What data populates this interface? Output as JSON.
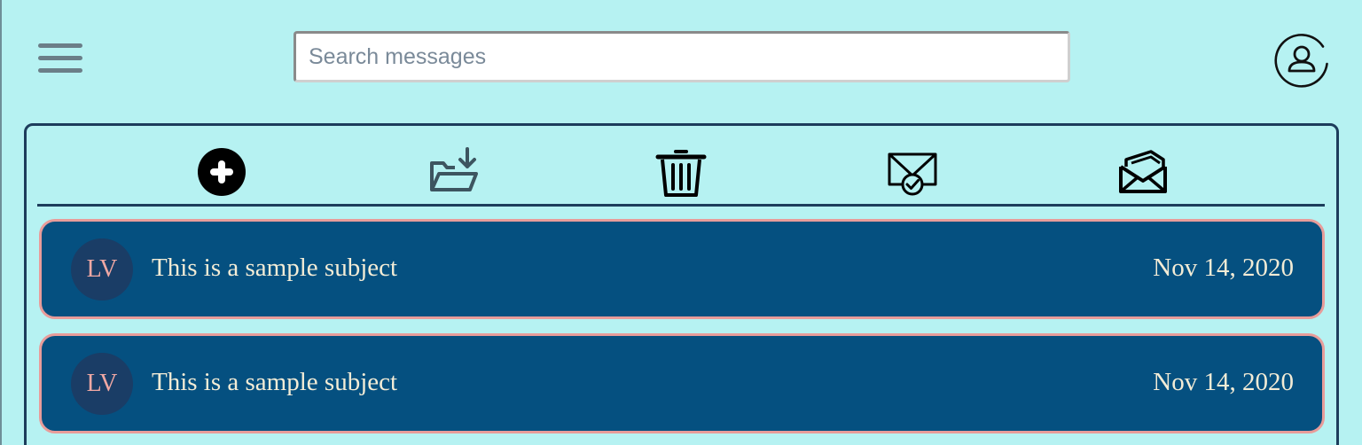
{
  "header": {
    "menu_icon": "hamburger-menu-icon",
    "search": {
      "placeholder": "Search messages",
      "value": ""
    },
    "profile_icon": "user-circle-icon"
  },
  "toolbar": {
    "items": [
      {
        "name": "compose",
        "icon": "plus-circle-icon"
      },
      {
        "name": "move-to-folder",
        "icon": "folder-download-icon"
      },
      {
        "name": "delete",
        "icon": "trash-icon"
      },
      {
        "name": "mark-read",
        "icon": "envelope-check-icon"
      },
      {
        "name": "mark-unread",
        "icon": "envelope-open-icon"
      }
    ]
  },
  "messages": [
    {
      "initials": "LV",
      "subject": "This is a sample subject",
      "date": "Nov 14, 2020"
    },
    {
      "initials": "LV",
      "subject": "This is a sample subject",
      "date": "Nov 14, 2020"
    }
  ],
  "colors": {
    "page_background": "#b6f2f2",
    "panel_border": "#1d3d5c",
    "message_background": "#055080",
    "message_border": "#e89c9a",
    "avatar_background": "#1a3d66",
    "avatar_text": "#f0a8a4",
    "message_text": "#f3ecd6"
  }
}
